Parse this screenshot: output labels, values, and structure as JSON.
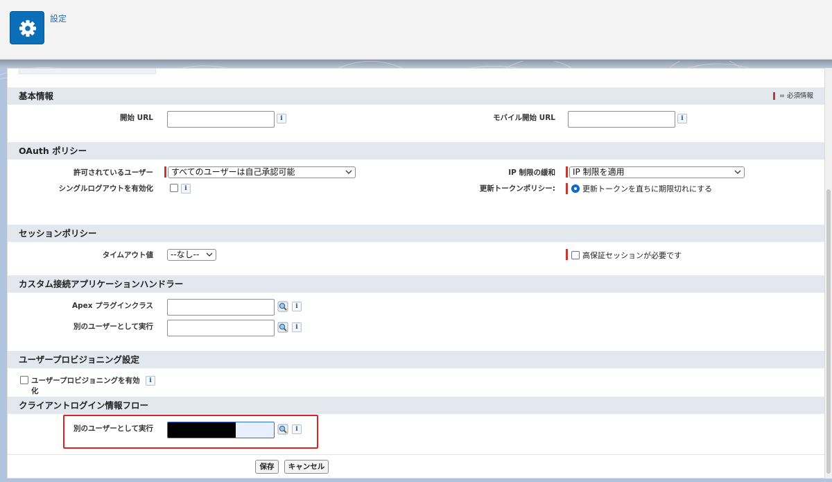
{
  "header": {
    "app_title": "設定",
    "icon": "gear-icon"
  },
  "sections": {
    "basic": {
      "title": "基本情報",
      "required_note": "= 必須情報",
      "start_url_label": "開始 URL",
      "mobile_start_url_label": "モバイル開始 URL"
    },
    "oauth": {
      "title": "OAuth ポリシー",
      "permitted_users_label": "許可されているユーザー",
      "permitted_users_value": "すべてのユーザーは自己承認可能",
      "ip_relax_label": "IP 制限の緩和",
      "ip_relax_value": "IP 制限を適用",
      "single_logout_label": "シングルログアウトを有効化",
      "refresh_policy_label": "更新トークンポリシー:",
      "refresh_policy_option": "更新トークンを直ちに期限切れにする"
    },
    "session": {
      "title": "セッションポリシー",
      "timeout_label": "タイムアウト値",
      "timeout_value": "--なし--",
      "high_assurance_label": "高保証セッションが必要です"
    },
    "handler": {
      "title": "カスタム接続アプリケーションハンドラー",
      "apex_plugin_label": "Apex プラグインクラス",
      "run_as_label": "別のユーザーとして実行"
    },
    "provisioning": {
      "title": "ユーザープロビジョニング設定",
      "enable_label": "ユーザープロビジョニングを有効化"
    },
    "client_credentials": {
      "title": "クライアントログイン情報フロー",
      "run_as_label": "別のユーザーとして実行"
    }
  },
  "buttons": {
    "save": "保存",
    "cancel": "キャンセル"
  },
  "colors": {
    "accent": "#0b6eb8",
    "required": "#c23934",
    "highlight_box": "#e02020"
  }
}
